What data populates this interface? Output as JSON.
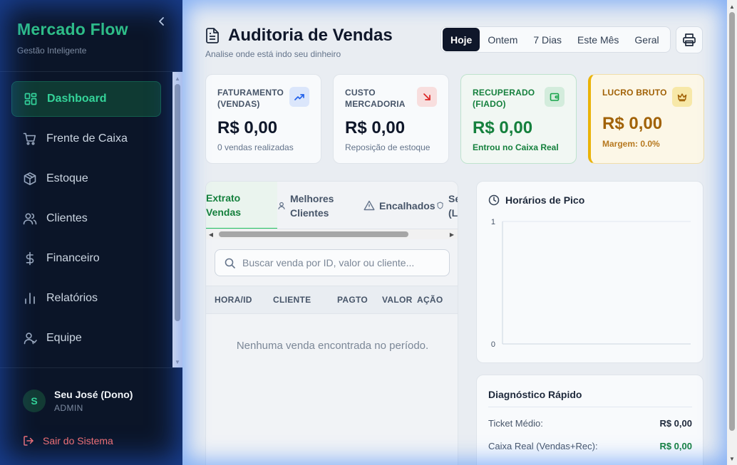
{
  "brand": {
    "title": "Mercado Flow",
    "subtitle": "Gestão Inteligente"
  },
  "sidebar": {
    "items": [
      {
        "label": "Dashboard",
        "icon": "dashboard-icon",
        "active": true
      },
      {
        "label": "Frente de Caixa",
        "icon": "cart-icon"
      },
      {
        "label": "Estoque",
        "icon": "box-icon"
      },
      {
        "label": "Clientes",
        "icon": "users-icon"
      },
      {
        "label": "Financeiro",
        "icon": "dollar-icon"
      },
      {
        "label": "Relatórios",
        "icon": "bar-chart-icon"
      },
      {
        "label": "Equipe",
        "icon": "user-icon"
      }
    ]
  },
  "user": {
    "initial": "S",
    "name": "Seu José (Dono)",
    "role": "ADMIN"
  },
  "logout_label": "Sair do Sistema",
  "page": {
    "title": "Auditoria de Vendas",
    "subtitle": "Analise onde está indo seu dinheiro"
  },
  "filters": {
    "items": [
      "Hoje",
      "Ontem",
      "7 Dias",
      "Este Mês",
      "Geral"
    ],
    "selected": "Hoje"
  },
  "cards": [
    {
      "label": "FATURAMENTO (VENDAS)",
      "value": "R$ 0,00",
      "note": "0 vendas realizadas",
      "icon": "trending-up-icon",
      "icon_color": "#2563eb",
      "icon_bg": "#dbe6fb"
    },
    {
      "label": "CUSTO MERCADORIA",
      "value": "R$ 0,00",
      "note": "Reposição de estoque",
      "icon": "arrow-down-right-icon",
      "icon_color": "#dc2626",
      "icon_bg": "#f8dede"
    },
    {
      "label": "RECUPERADO (FIADO)",
      "value": "R$ 0,00",
      "note": "Entrou no Caixa Real",
      "icon": "wallet-icon",
      "icon_color": "#16a34a",
      "icon_bg": "#d3ecdc"
    },
    {
      "label": "LUCRO BRUTO",
      "value": "R$ 0,00",
      "note": "Margem: 0.0%",
      "icon": "crown-icon",
      "icon_color": "#a16207",
      "icon_bg": "#f7e8a8"
    }
  ],
  "tabs": [
    {
      "label": "Extrato Vendas",
      "active": true
    },
    {
      "label": "Melhores Clientes",
      "icon": "user-icon"
    },
    {
      "label": "Encalhados",
      "icon": "alert-triangle-icon"
    },
    {
      "label": "Se (L",
      "icon": "shield-icon"
    }
  ],
  "search": {
    "placeholder": "Buscar venda por ID, valor ou cliente...",
    "value": ""
  },
  "table": {
    "columns": [
      "HORA/ID",
      "CLIENTE",
      "PAGTO",
      "VALOR",
      "AÇÃO"
    ],
    "rows": [],
    "empty_message": "Nenhuma venda encontrada no período."
  },
  "peak": {
    "title": "Horários de Pico",
    "chart_data": {
      "type": "bar",
      "title": "Horários de Pico",
      "categories": [],
      "values": [],
      "ylim": [
        0,
        1
      ],
      "y_ticks": [
        "0",
        "1"
      ],
      "grid": true
    }
  },
  "diagnostic": {
    "title": "Diagnóstico Rápido",
    "rows": [
      {
        "label": "Ticket Médio:",
        "value": "R$ 0,00"
      },
      {
        "label": "Caixa Real (Vendas+Rec):",
        "value": "R$ 0,00"
      }
    ]
  },
  "colors": {
    "accent": "#22c55e",
    "brand": "#2fbf87",
    "sidebar_bg": "#0b1528",
    "danger": "#f87171",
    "gold": "#a16207"
  }
}
